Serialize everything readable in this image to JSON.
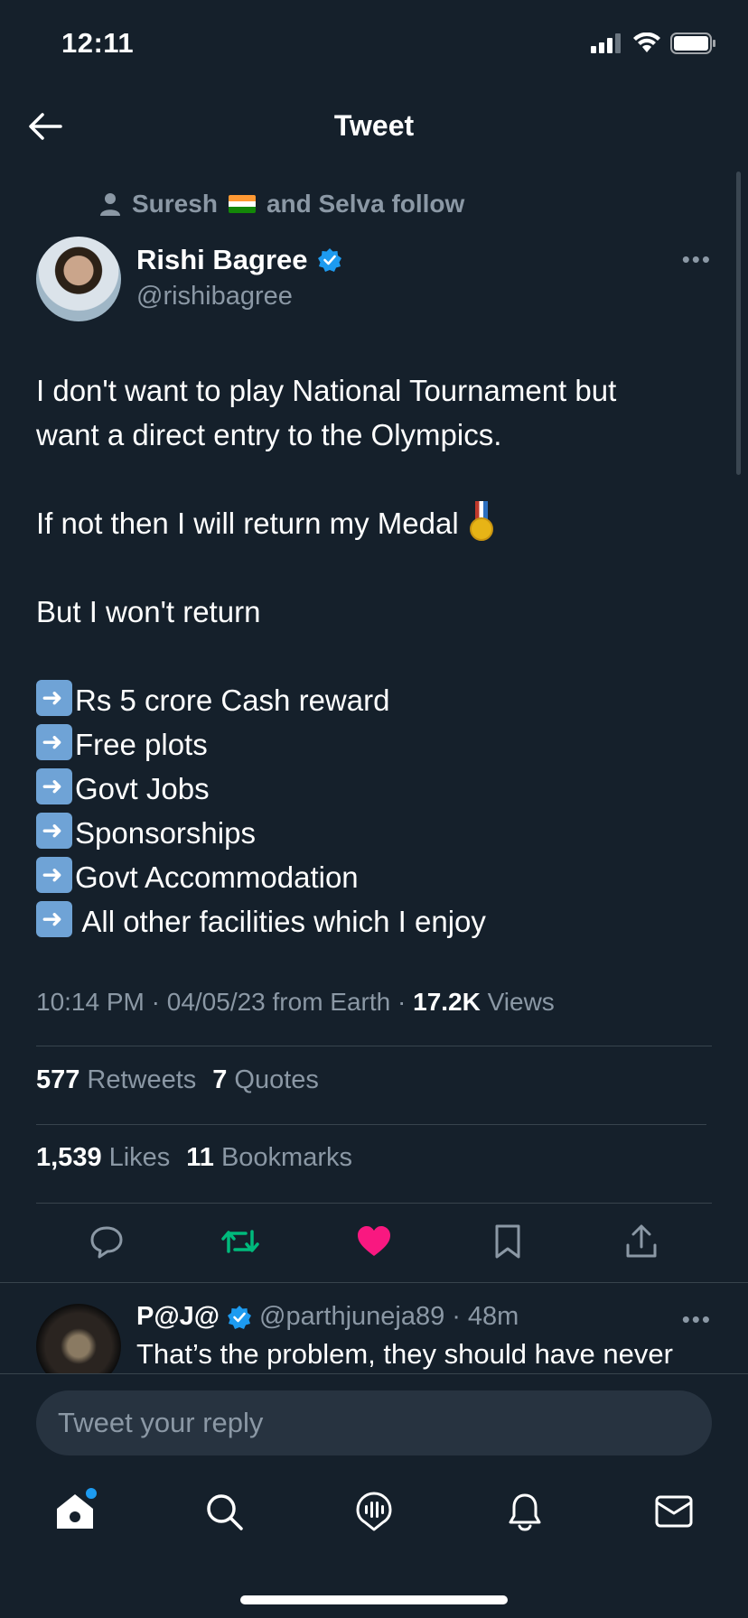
{
  "status_bar": {
    "time": "12:11"
  },
  "header": {
    "title": "Tweet"
  },
  "social_context": {
    "part1": "Suresh",
    "part2": "and Selva follow"
  },
  "author": {
    "name": "Rishi Bagree",
    "handle": "@rishibagree"
  },
  "tweet": {
    "line1": "I don't want to play National Tournament but",
    "line2": "want a direct entry to the Olympics.",
    "line3": "If not then I will return my Medal",
    "line4": "But I won't return",
    "list": [
      "Rs 5 crore Cash reward",
      "Free plots",
      "Govt Jobs",
      "Sponsorships",
      "Govt Accommodation",
      " All other facilities which I enjoy"
    ]
  },
  "meta": {
    "time": "10:14 PM",
    "date": "04/05/23",
    "source": "from Earth",
    "views_count": "17.2K",
    "views_label": "Views"
  },
  "stats": {
    "retweets_count": "577",
    "retweets_label": "Retweets",
    "quotes_count": "7",
    "quotes_label": "Quotes",
    "likes_count": "1,539",
    "likes_label": "Likes",
    "bookmarks_count": "11",
    "bookmarks_label": "Bookmarks"
  },
  "actions": {
    "reply_icon": "reply-icon",
    "retweet_icon": "retweet-icon",
    "like_icon": "heart-icon",
    "bookmark_icon": "bookmark-icon",
    "share_icon": "share-icon",
    "retweet_color": "#00ba7c",
    "like_color": "#f91880"
  },
  "reply": {
    "name": "P@J@",
    "handle": "@parthjuneja89",
    "time": "48m",
    "text": "That’s the problem, they should have never"
  },
  "compose": {
    "placeholder": "Tweet your reply"
  },
  "tabbar": [
    "home-icon",
    "search-icon",
    "spaces-icon",
    "notifications-icon",
    "messages-icon"
  ],
  "colors": {
    "background": "#15202b",
    "accent": "#1d9bf0",
    "muted": "#8b98a5"
  }
}
